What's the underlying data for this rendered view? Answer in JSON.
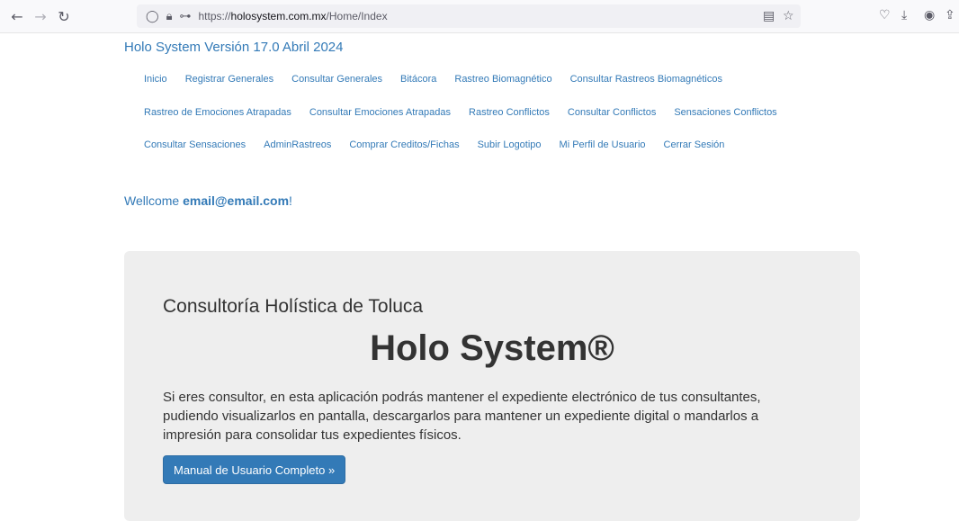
{
  "browser": {
    "url_prefix": "https://",
    "url_domain": "holosystem.com.mx",
    "url_path": "/Home/Index"
  },
  "site": {
    "brand": "Holo System Versión 17.0 Abril 2024"
  },
  "nav": {
    "row1": [
      "Inicio",
      "Registrar Generales",
      "Consultar Generales",
      "Bitácora",
      "Rastreo Biomagnético",
      "Consultar Rastreos Biomagnéticos"
    ],
    "row2": [
      "Rastreo de Emociones Atrapadas",
      "Consultar Emociones Atrapadas",
      "Rastreo Conflictos",
      "Consultar Conflictos",
      "Sensaciones Conflictos"
    ],
    "row3": [
      "Consultar Sensaciones",
      "AdminRastreos",
      "Comprar Creditos/Fichas",
      "Subir Logotipo",
      "Mi Perfil de Usuario",
      "Cerrar Sesión"
    ]
  },
  "welcome": {
    "prefix": "Wellcome ",
    "email": "email@email.com",
    "suffix": "!"
  },
  "jumbotron": {
    "subtitle": "Consultoría Holística de Toluca",
    "title": "Holo System®",
    "text": "Si eres consultor, en esta aplicación podrás mantener el expediente electrónico de tus consultantes, pudiendo visualizarlos en pantalla, descargarlos para mantener un expediente digital o mandarlos a impresión para consolidar tus expedientes físicos.",
    "button": "Manual de Usuario Completo »"
  }
}
